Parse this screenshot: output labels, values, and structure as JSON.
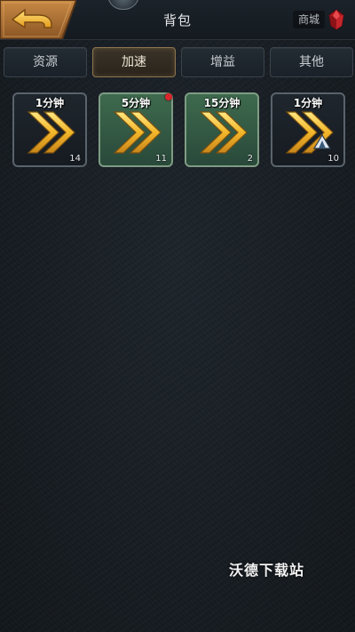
{
  "header": {
    "title": "背包",
    "shop_label": "商城",
    "back_icon": "back-arrow-icon",
    "shop_icon": "ruby-gem-icon"
  },
  "tabs": [
    {
      "label": "资源",
      "active": false
    },
    {
      "label": "加速",
      "active": true
    },
    {
      "label": "增益",
      "active": false
    },
    {
      "label": "其他",
      "active": false
    }
  ],
  "items": [
    {
      "label": "1分钟",
      "count": "14",
      "highlighted": false,
      "has_notification": false,
      "badge_icon": ""
    },
    {
      "label": "5分钟",
      "count": "11",
      "highlighted": true,
      "has_notification": true,
      "badge_icon": ""
    },
    {
      "label": "15分钟",
      "count": "2",
      "highlighted": true,
      "has_notification": false,
      "badge_icon": ""
    },
    {
      "label": "1分钟",
      "count": "10",
      "highlighted": false,
      "has_notification": false,
      "badge_icon": "tent-icon"
    }
  ],
  "watermark": "沃德下载站",
  "colors": {
    "background": "#141a1f",
    "highlight_green": "#3e6a4e",
    "arrow_gold": "#f0b82a",
    "notification_red": "#d8262a"
  }
}
